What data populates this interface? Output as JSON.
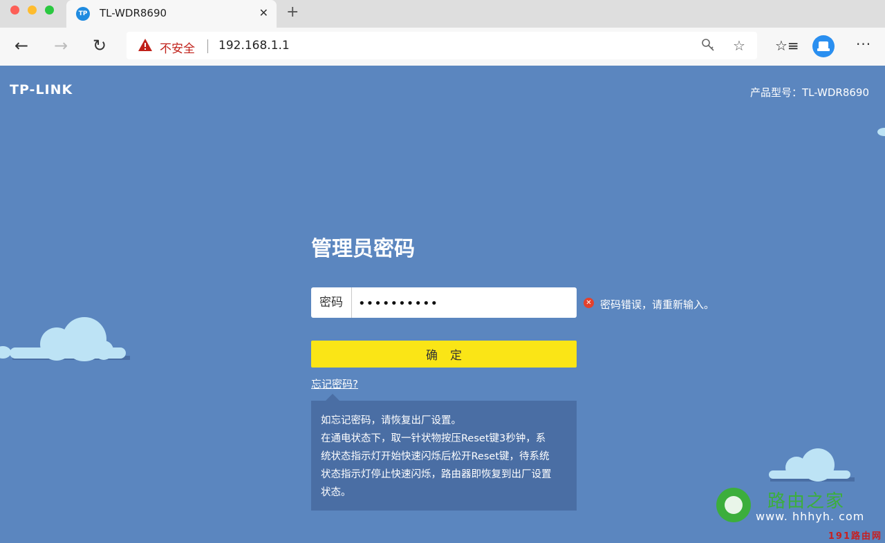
{
  "browser": {
    "tab_title": "TL-WDR8690",
    "tab_favicon": "TP",
    "close_label": "✕",
    "new_tab_label": "+",
    "security_label": "不安全",
    "url": "192.168.1.1",
    "icons": {
      "back": "←",
      "forward": "→",
      "reload": "↻",
      "key": "🔍",
      "star": "☆",
      "favorites": "☆≡",
      "more": "···"
    }
  },
  "page": {
    "logo": "TP-LINK",
    "model": "产品型号：TL-WDR8690",
    "title": "管理员密码",
    "password_label": "密码",
    "password_value": "••••••••••",
    "error_icon": "✕",
    "error_text": "密码错误，请重新输入。",
    "confirm_label": "确定",
    "forgot_label": "忘记密码?",
    "tip_lines": [
      "如忘记密码，请恢复出厂设置。",
      "在通电状态下，取一针状物按压Reset键3秒钟，系",
      "统状态指示灯开始快速闪烁后松开Reset键，待系统",
      "状态指示灯停止快速闪烁，路由器即恢复到出厂设置",
      "状态。"
    ]
  },
  "watermark": {
    "name": "路由之家",
    "url": "www. hhhyh. com",
    "corner": "191路由网"
  },
  "colors": {
    "page_bg": "#5b86bf",
    "confirm_bg": "#fae516",
    "tip_bg": "#4a6ea4",
    "error": "#e4412c",
    "insecure": "#c0211a"
  }
}
